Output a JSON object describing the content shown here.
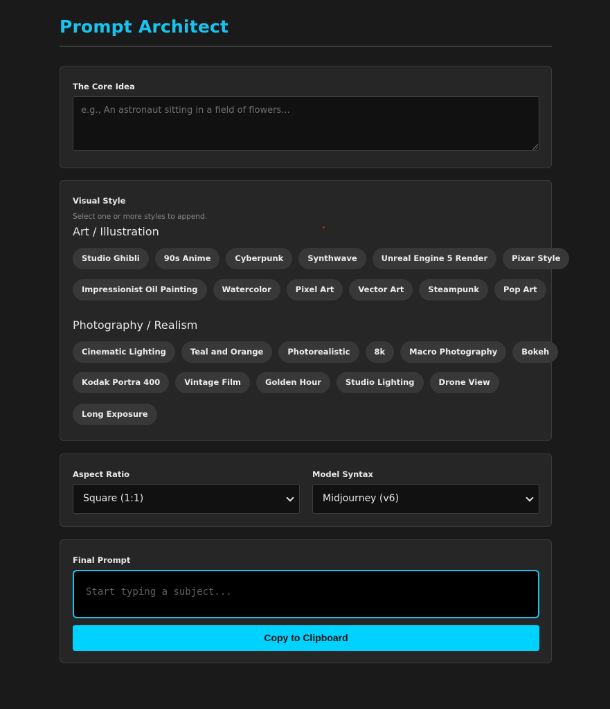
{
  "app": {
    "title": "Prompt Architect"
  },
  "core_idea": {
    "label": "The Core Idea",
    "placeholder": "e.g., An astronaut sitting in a field of flowers..."
  },
  "visual_style": {
    "label": "Visual Style",
    "hint": "Select one or more styles to append.",
    "groups": [
      {
        "title": "Art / Illustration",
        "rows": [
          [
            "Studio Ghibli",
            "90s Anime",
            "Cyberpunk",
            "Synthwave",
            "Unreal Engine 5 Render",
            "Pixar Style"
          ],
          [
            "Impressionist Oil Painting",
            "Watercolor",
            "Pixel Art",
            "Vector Art",
            "Steampunk",
            "Pop Art"
          ]
        ]
      },
      {
        "title": "Photography / Realism",
        "rows": [
          [
            "Cinematic Lighting",
            "Teal and Orange",
            "Photorealistic",
            "8k",
            "Macro Photography",
            "Bokeh"
          ],
          [
            "Kodak Portra 400",
            "Vintage Film",
            "Golden Hour",
            "Studio Lighting",
            "Drone View"
          ],
          [
            "Long Exposure"
          ]
        ]
      }
    ]
  },
  "settings": {
    "aspect_label": "Aspect Ratio",
    "aspect_value": "Square (1:1)",
    "model_label": "Model Syntax",
    "model_value": "Midjourney (v6)"
  },
  "final": {
    "label": "Final Prompt",
    "placeholder": "Start typing a subject...",
    "copy_label": "Copy to Clipboard"
  },
  "colors": {
    "accent": "#19c3ef",
    "button": "#00d2ff",
    "background": "#1a1a1a",
    "card": "#262626",
    "chip": "#383838"
  }
}
